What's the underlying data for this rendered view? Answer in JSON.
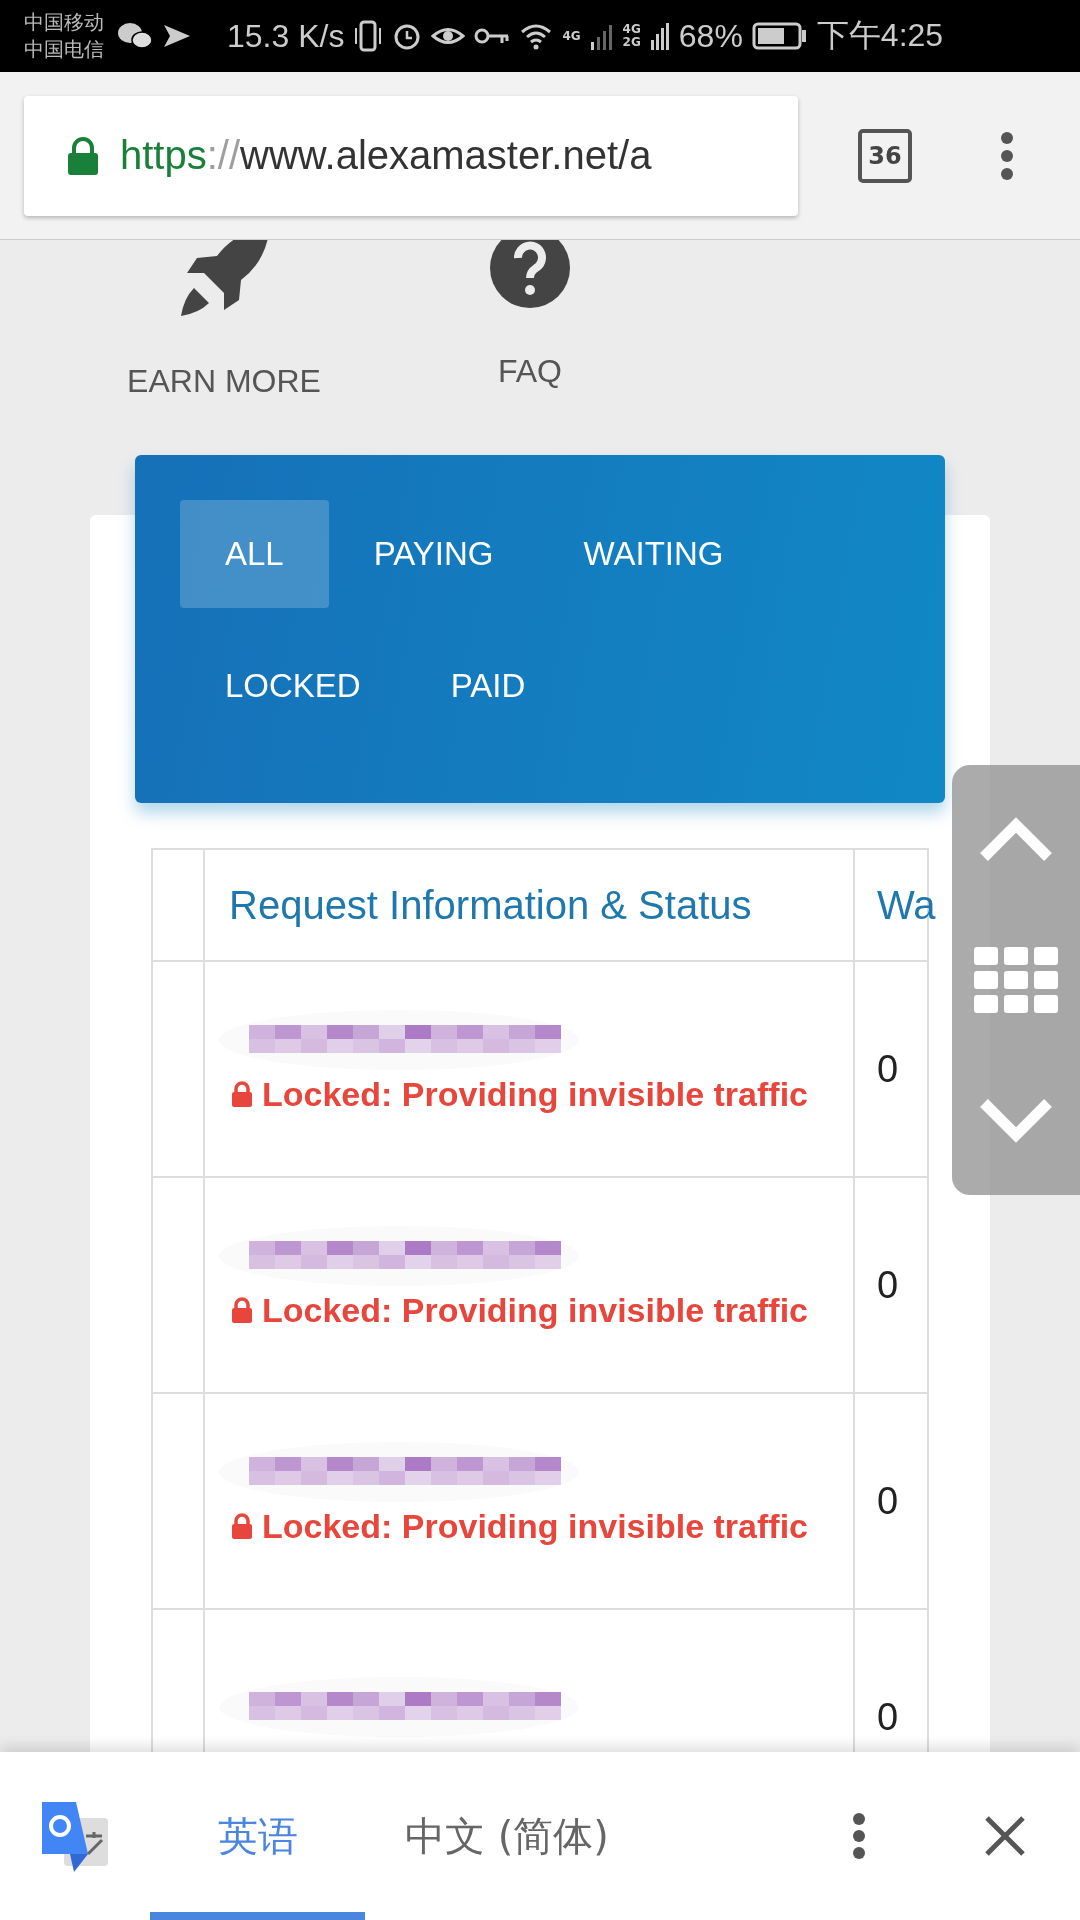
{
  "status_bar": {
    "carriers": [
      "中国移动",
      "中国电信"
    ],
    "speed": "15.3 K/s",
    "network_labels": [
      "4G",
      "4G",
      "2G"
    ],
    "battery": "68%",
    "time": "下午4:25"
  },
  "browser": {
    "url_parts": [
      {
        "kind": "scheme",
        "text": "https"
      },
      {
        "kind": "separator",
        "text": "://"
      },
      {
        "kind": "host",
        "text": "www.alexamaster.net/a"
      }
    ],
    "tab_count": "36"
  },
  "nav": [
    {
      "label": "EARN MORE",
      "kind": "rocket"
    },
    {
      "label": "FAQ",
      "kind": "help"
    }
  ],
  "filter_tab_rows": [
    [
      {
        "label": "ALL",
        "selected": true
      },
      {
        "label": "PAYING",
        "selected": false
      },
      {
        "label": "WAITING",
        "selected": false
      }
    ],
    [
      {
        "label": "LOCKED",
        "selected": false
      },
      {
        "label": "PAID",
        "selected": false
      }
    ]
  ],
  "table": {
    "column_2": "Request Information & Status",
    "column_3": "Wa",
    "rows": [
      {
        "status": "Locked: Providing invisible traffic",
        "kind": "locked",
        "column_3": "0"
      },
      {
        "status": "Locked: Providing invisible traffic",
        "kind": "locked",
        "column_3": "0"
      },
      {
        "status": "Locked: Providing invisible traffic",
        "kind": "locked",
        "column_3": "0"
      },
      {
        "column_3": "0"
      }
    ]
  },
  "translate_bar": {
    "languages": [
      {
        "label": "英语",
        "selected": true
      },
      {
        "label": "中文 (简体)",
        "selected": false
      }
    ]
  }
}
